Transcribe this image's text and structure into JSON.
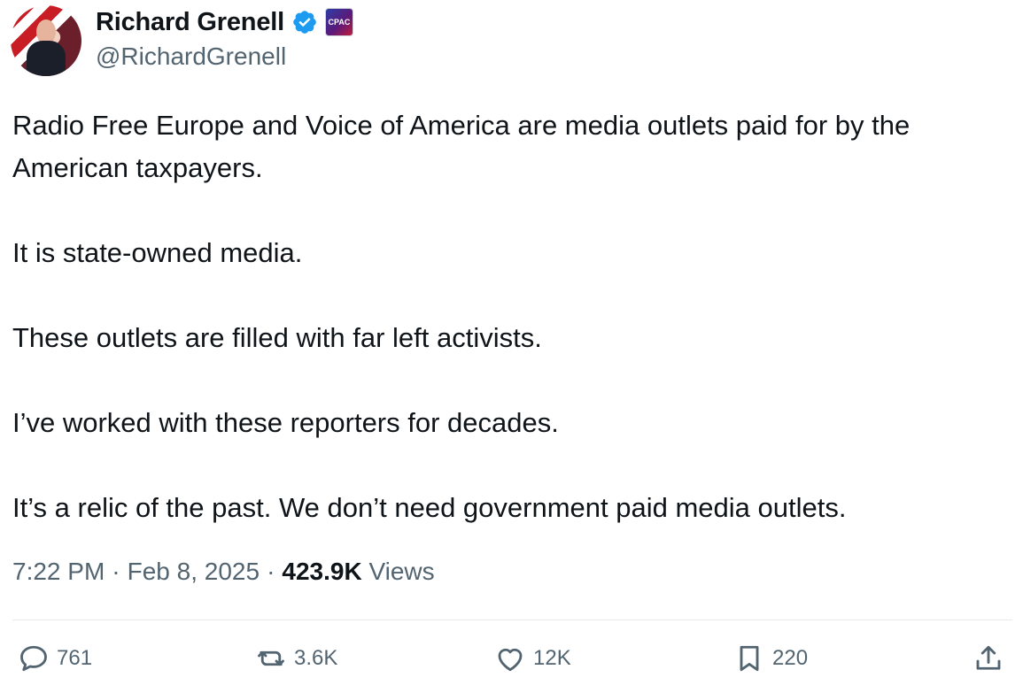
{
  "author": {
    "display_name": "Richard Grenell",
    "handle": "@RichardGrenell",
    "affiliate_badge_text": "CPAC"
  },
  "tweet": {
    "paragraphs": [
      "Radio Free Europe and Voice of America are media outlets paid for by the American taxpayers.",
      "It is state-owned media.",
      "These outlets are filled with far left activists.",
      "I’ve worked with these reporters for decades.",
      "It’s a relic of the past. We don’t need government paid media outlets."
    ]
  },
  "meta": {
    "time": "7:22 PM",
    "separator": "·",
    "date": "Feb 8, 2025",
    "views_count": "423.9K",
    "views_label": "Views"
  },
  "actions": {
    "replies": "761",
    "reposts": "3.6K",
    "likes": "12K",
    "bookmarks": "220"
  },
  "colors": {
    "text": "#0f1419",
    "secondary": "#536471",
    "verified_blue": "#1d9bf0",
    "divider": "#e7e9ea"
  },
  "icons": {
    "verified": "verified-badge-icon",
    "reply": "speech-bubble-icon",
    "repost": "repost-arrows-icon",
    "like": "heart-icon",
    "bookmark": "bookmark-icon",
    "share": "share-upload-icon"
  }
}
